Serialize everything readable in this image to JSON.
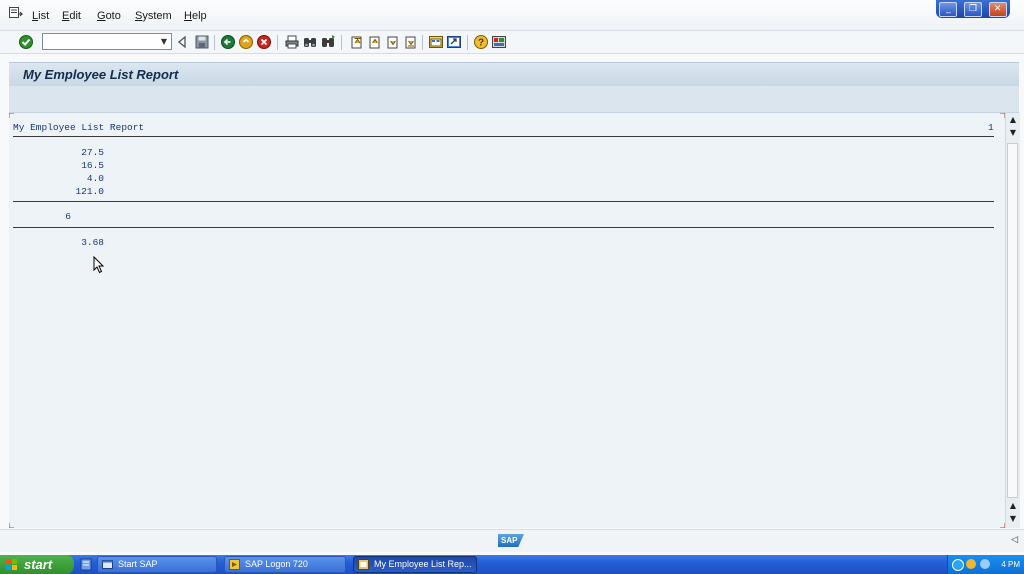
{
  "menu": {
    "items": [
      {
        "label": "List",
        "underline": "L",
        "rest": "ist"
      },
      {
        "label": "Edit",
        "underline": "E",
        "rest": "dit"
      },
      {
        "label": "Goto",
        "underline": "G",
        "rest": "oto"
      },
      {
        "label": "System",
        "underline": "S",
        "rest": "ystem"
      },
      {
        "label": "Help",
        "underline": "H",
        "rest": "elp"
      }
    ]
  },
  "window_controls": {
    "minimize": "_",
    "restore": "❐",
    "close": "✕"
  },
  "toolbar": {
    "command_field_value": "",
    "icons": [
      "enter-icon",
      "back-triangle-icon",
      "save-icon",
      "back-icon",
      "exit-icon",
      "cancel-icon",
      "print-icon",
      "find-icon",
      "find-next-icon",
      "first-page-icon",
      "previous-page-icon",
      "next-page-icon",
      "last-page-icon",
      "create-session-icon",
      "shortcut-icon",
      "help-icon",
      "layout-icon"
    ]
  },
  "title": "My Employee List Report",
  "list": {
    "header_title": "My Employee List Report",
    "page_number": "1",
    "values": [
      "27.5",
      "16.5",
      "4.0",
      "121.0"
    ],
    "count": "6",
    "average": "3.68"
  },
  "status": {
    "logo": "SAP"
  },
  "taskbar": {
    "start_label": "start",
    "tasks": [
      {
        "label": "Start SAP",
        "active": false
      },
      {
        "label": "SAP Logon 720",
        "active": false
      },
      {
        "label": "My Employee List Rep...",
        "active": true
      }
    ],
    "clock": "4 PM"
  },
  "colors": {
    "list_text": "#15367a",
    "title_text": "#142c4a",
    "taskbar": "#245ed8",
    "start_button": "#3ca03a"
  }
}
